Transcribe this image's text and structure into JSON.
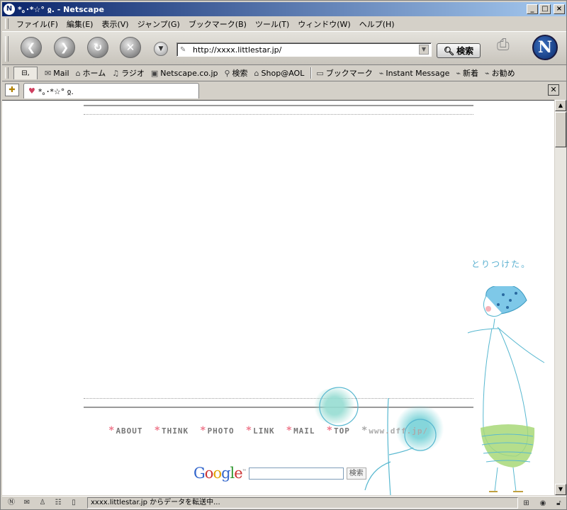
{
  "window": {
    "title": "*｡･*☆° ჲ. - Netscape",
    "app_icon": "netscape-n-icon",
    "buttons": [
      "minimize",
      "maximize",
      "close"
    ]
  },
  "menu": {
    "items": [
      "ファイル(F)",
      "編集(E)",
      "表示(V)",
      "ジャンプ(G)",
      "ブックマーク(B)",
      "ツール(T)",
      "ウィンドウ(W)",
      "ヘルプ(H)"
    ]
  },
  "navbar": {
    "url": "http://xxxx.littlestar.jp/",
    "search_label": "検索"
  },
  "personal_toolbar": {
    "items": [
      {
        "label": "Mail",
        "icon": "mail-icon"
      },
      {
        "label": "ホーム",
        "icon": "home-icon"
      },
      {
        "label": "ラジオ",
        "icon": "radio-icon"
      },
      {
        "label": "Netscape.co.jp",
        "icon": "my-icon"
      },
      {
        "label": "検索",
        "icon": "search-icon"
      },
      {
        "label": "Shop@AOL",
        "icon": "shop-icon"
      },
      {
        "label": "ブックマーク",
        "icon": "bookmark-folder-icon"
      },
      {
        "label": "Instant Message",
        "icon": "bookmark-icon"
      },
      {
        "label": "新着",
        "icon": "bookmark-icon"
      },
      {
        "label": "お勧め",
        "icon": "bookmark-icon"
      }
    ]
  },
  "tab": {
    "label": "*｡･*☆° ჲ."
  },
  "page": {
    "nav_links": [
      "ABOUT",
      "THINK",
      "PHOTO",
      "LINK",
      "MAIL",
      "TOP"
    ],
    "site_link": "www.dff.jp/",
    "google_logo": "Google",
    "google_button": "検索",
    "handwriting": "とりつけた。"
  },
  "status": {
    "text": "xxxx.littlestar.jp からデータを転送中..."
  },
  "colors": {
    "title_bar": "#0a246a",
    "nav_star": "#ef7b8e",
    "drawing_blue": "#58b8d0",
    "skirt_green": "#a8d878"
  }
}
